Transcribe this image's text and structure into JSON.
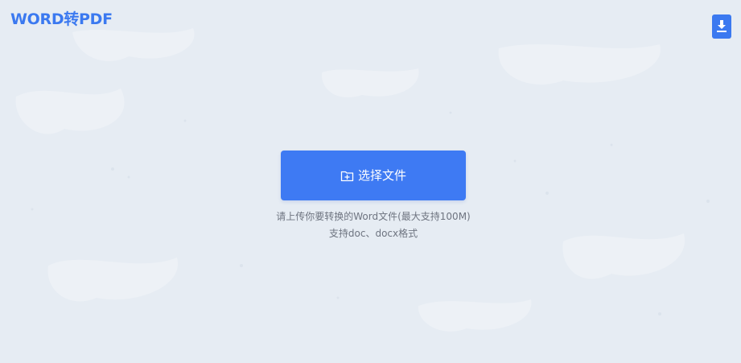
{
  "header": {
    "title": "WORD转PDF"
  },
  "toolbar": {
    "download_icon": "download-icon"
  },
  "upload": {
    "button_label": "选择文件",
    "button_icon": "folder-add-icon",
    "hint_line1": "请上传你要转换的Word文件(最大支持100M)",
    "hint_line2": "支持doc、docx格式"
  },
  "colors": {
    "background": "#e6ecf3",
    "accent": "#3b79f0",
    "button": "#3e7af3",
    "hint_text": "#6e7480"
  }
}
